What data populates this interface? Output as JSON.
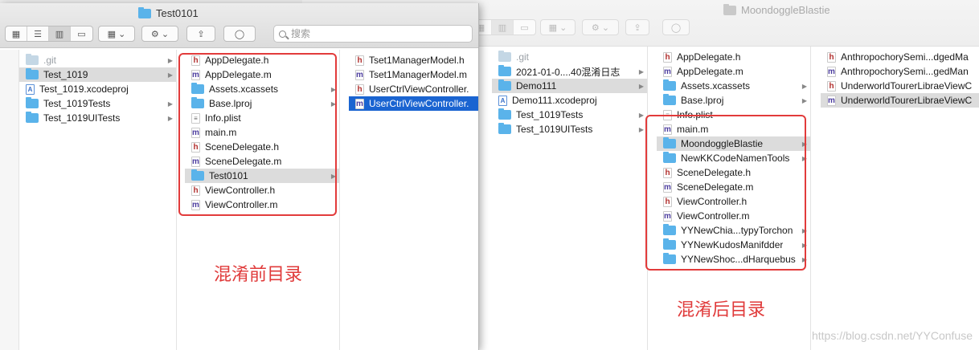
{
  "right_window": {
    "title": "MoondoggleBlastie",
    "columns": [
      [
        {
          "name": ".git",
          "icon": "folder-pale",
          "dim": true
        },
        {
          "name": "2021-01-0....40混淆日志",
          "icon": "folder",
          "arrow": true
        },
        {
          "name": "Demo111",
          "icon": "folder",
          "arrow": true,
          "selected": true
        },
        {
          "name": "Demo111.xcodeproj",
          "icon": "xcodeproj"
        },
        {
          "name": "Test_1019Tests",
          "icon": "folder",
          "arrow": true
        },
        {
          "name": "Test_1019UITests",
          "icon": "folder",
          "arrow": true
        }
      ],
      [
        {
          "name": "AppDelegate.h",
          "icon": "h"
        },
        {
          "name": "AppDelegate.m",
          "icon": "m"
        },
        {
          "name": "Assets.xcassets",
          "icon": "folder",
          "arrow": true
        },
        {
          "name": "Base.lproj",
          "icon": "folder",
          "arrow": true
        },
        {
          "name": "Info.plist",
          "icon": "plist"
        },
        {
          "name": "main.m",
          "icon": "m"
        },
        {
          "name": "MoondoggleBlastie",
          "icon": "folder",
          "arrow": true,
          "selected": true
        },
        {
          "name": "NewKKCodeNamenTools",
          "icon": "folder",
          "arrow": true
        },
        {
          "name": "SceneDelegate.h",
          "icon": "h"
        },
        {
          "name": "SceneDelegate.m",
          "icon": "m"
        },
        {
          "name": "ViewController.h",
          "icon": "h"
        },
        {
          "name": "ViewController.m",
          "icon": "m"
        },
        {
          "name": "YYNewChia...typyTorchon",
          "icon": "folder",
          "arrow": true
        },
        {
          "name": "YYNewKudosManifdder",
          "icon": "folder",
          "arrow": true
        },
        {
          "name": "YYNewShoc...dHarquebus",
          "icon": "folder",
          "arrow": true
        }
      ],
      [
        {
          "name": "AnthropochorySemi...dgedMa",
          "icon": "h"
        },
        {
          "name": "AnthropochorySemi...gedMan",
          "icon": "m"
        },
        {
          "name": "UnderworldTourerLibraeViewC",
          "icon": "h"
        },
        {
          "name": "UnderworldTourerLibraeViewC",
          "icon": "m",
          "selected": true
        }
      ]
    ]
  },
  "left_window": {
    "title": "Test0101",
    "search_placeholder": "搜索",
    "columns": [
      [
        {
          "name": ".git",
          "icon": "folder-pale",
          "dim": true,
          "arrow": true
        },
        {
          "name": "Test_1019",
          "icon": "folder",
          "arrow": true,
          "selected": true
        },
        {
          "name": "Test_1019.xcodeproj",
          "icon": "xcodeproj"
        },
        {
          "name": "Test_1019Tests",
          "icon": "folder",
          "arrow": true
        },
        {
          "name": "Test_1019UITests",
          "icon": "folder",
          "arrow": true
        }
      ],
      [
        {
          "name": "AppDelegate.h",
          "icon": "h"
        },
        {
          "name": "AppDelegate.m",
          "icon": "m"
        },
        {
          "name": "Assets.xcassets",
          "icon": "folder",
          "arrow": true
        },
        {
          "name": "Base.lproj",
          "icon": "folder",
          "arrow": true
        },
        {
          "name": "Info.plist",
          "icon": "plist"
        },
        {
          "name": "main.m",
          "icon": "m"
        },
        {
          "name": "SceneDelegate.h",
          "icon": "h"
        },
        {
          "name": "SceneDelegate.m",
          "icon": "m"
        },
        {
          "name": "Test0101",
          "icon": "folder",
          "arrow": true,
          "selected": true
        },
        {
          "name": "ViewController.h",
          "icon": "h"
        },
        {
          "name": "ViewController.m",
          "icon": "m"
        }
      ],
      [
        {
          "name": "Tset1ManagerModel.h",
          "icon": "h"
        },
        {
          "name": "Tset1ManagerModel.m",
          "icon": "m"
        },
        {
          "name": "UserCtrlViewController.",
          "icon": "h"
        },
        {
          "name": "UserCtrlViewController.",
          "icon": "m",
          "selected_blue": true
        }
      ]
    ]
  },
  "annotations": {
    "before_label": "混淆前目录",
    "after_label": "混淆后目录"
  },
  "watermark": "https://blog.csdn.net/YYConfuse",
  "colors": {
    "folder": "#5ab3ea",
    "selection": "#dcdcdc",
    "selection_active": "#1a64d1",
    "annotation": "#e03a3a"
  }
}
